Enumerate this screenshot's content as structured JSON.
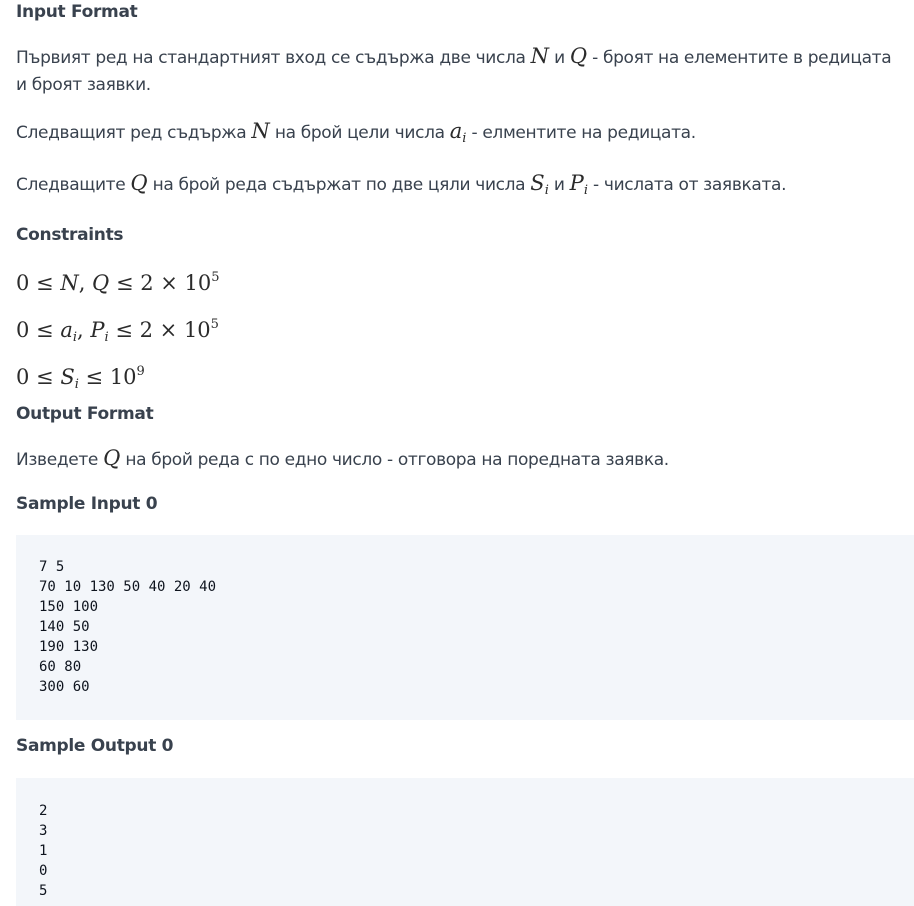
{
  "sections": {
    "input_format_heading": "Input Format",
    "constraints_heading": "Constraints",
    "output_format_heading": "Output Format",
    "sample_input_heading": "Sample Input 0",
    "sample_output_heading": "Sample Output 0"
  },
  "input_format": {
    "line1": {
      "a": "Първият ред на стандартният вход се съдържа две числа ",
      "var1": "N",
      "b": " и ",
      "var2": "Q",
      "c": " - броят на елементите в редицата и броят заявки."
    },
    "line2": {
      "a": "Следващият ред съдържа ",
      "var1": "N",
      "b": " на брой цели числа ",
      "var2": "a",
      "var2_sub": "i",
      "c": " - елментите на редицата."
    },
    "line3": {
      "a": "Следващите ",
      "var1": "Q",
      "b": " на брой реда съдържат по две цяли числа ",
      "var2": "S",
      "var2_sub": "i",
      "c": " и ",
      "var3": "P",
      "var3_sub": "i",
      "d": " - числата от заявката."
    }
  },
  "constraints": [
    {
      "p1": "0 ≤ ",
      "v1": "N",
      "p2": ", ",
      "v2": "Q",
      "p3": " ≤ 2 × 10",
      "exp": "5"
    },
    {
      "p1": "0 ≤ ",
      "v1": "a",
      "v1_sub": "i",
      "p2": ", ",
      "v2": "P",
      "v2_sub": "i",
      "p3": " ≤ 2 × 10",
      "exp": "5"
    },
    {
      "p1": "0 ≤ ",
      "v1": "S",
      "v1_sub": "i",
      "p3": " ≤ 10",
      "exp": "9"
    }
  ],
  "output_format": {
    "a": "Изведете ",
    "var1": "Q",
    "b": " на брой реда с по едно число - отговора на поредната заявка."
  },
  "sample_input": "7 5\n70 10 130 50 40 20 40\n150 100\n140 50\n190 130\n60 80\n300 60",
  "sample_output": "2\n3\n1\n0\n5",
  "colors": {
    "text": "#39424e",
    "code_background": "#f3f6fa",
    "code_text": "#0e141e"
  }
}
